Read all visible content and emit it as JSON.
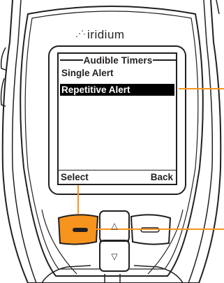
{
  "brand": {
    "logo_mark": "⋰·",
    "logo_text": "iridium"
  },
  "screen": {
    "title": "Audible Timers",
    "menu_items": [
      "Single Alert",
      "Repetitive Alert"
    ],
    "selected_index": 1,
    "softkeys": {
      "left": "Select",
      "right": "Back"
    }
  },
  "keypad": {
    "up_symbol": "△",
    "down_symbol": "▽"
  },
  "colors": {
    "callout": "#f7941d",
    "highlight_key": "#f7941d",
    "outline": "#231f20",
    "selection_bg": "#000000",
    "selection_text": "#ffffff"
  }
}
